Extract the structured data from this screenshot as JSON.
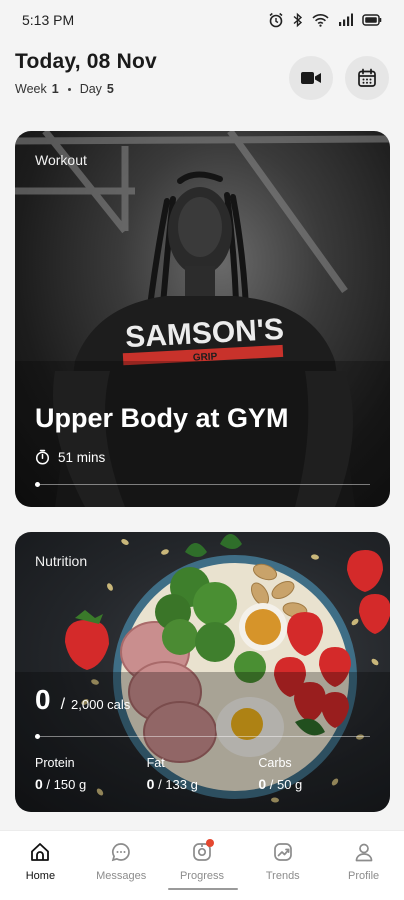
{
  "status_bar": {
    "time": "5:13 PM"
  },
  "header": {
    "date": "Today, 08 Nov",
    "week_label": "Week",
    "week_number": "1",
    "day_label": "Day",
    "day_number": "5"
  },
  "workout": {
    "tag": "Workout",
    "title": "Upper Body at GYM",
    "duration": "51 mins",
    "shirt_text": "SAMSON'S",
    "shirt_subtext": "GRIP",
    "progress": 0
  },
  "nutrition": {
    "tag": "Nutrition",
    "calories_consumed": "0",
    "calories_goal": "2,000 cals",
    "progress": 0,
    "macros": [
      {
        "label": "Protein",
        "consumed": "0",
        "goal": "150 g"
      },
      {
        "label": "Fat",
        "consumed": "0",
        "goal": "133 g"
      },
      {
        "label": "Carbs",
        "consumed": "0",
        "goal": "50 g"
      }
    ]
  },
  "nav": {
    "items": [
      {
        "label": "Home",
        "icon": "home-icon",
        "active": true
      },
      {
        "label": "Messages",
        "icon": "chat-icon",
        "active": false
      },
      {
        "label": "Progress",
        "icon": "progress-icon",
        "active": false,
        "badge": true
      },
      {
        "label": "Trends",
        "icon": "trends-icon",
        "active": false
      },
      {
        "label": "Profile",
        "icon": "profile-icon",
        "active": false
      }
    ]
  },
  "colors": {
    "badge": "#e5472f",
    "active_nav": "#111111",
    "inactive_nav": "#8c8c8c"
  }
}
